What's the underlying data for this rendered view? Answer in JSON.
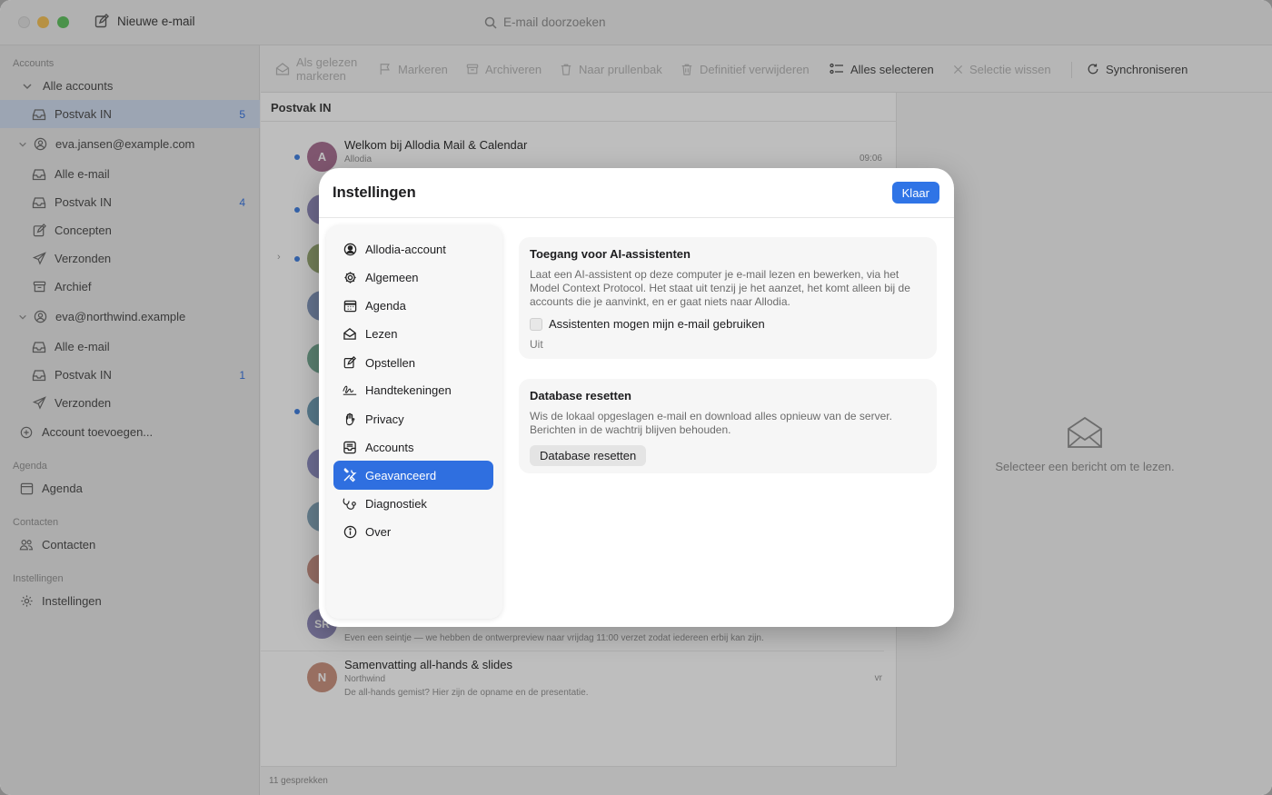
{
  "titlebar": {
    "new_mail": "Nieuwe e-mail",
    "search_placeholder": "E-mail doorzoeken"
  },
  "sidebar": {
    "accounts_header": "Accounts",
    "all_accounts": "Alle accounts",
    "inbox": "Postvak IN",
    "inbox_count": "5",
    "account1": {
      "email": "eva.jansen@example.com",
      "all_mail": "Alle e-mail",
      "inbox": "Postvak IN",
      "inbox_count": "4",
      "drafts": "Concepten",
      "sent": "Verzonden",
      "archive": "Archief"
    },
    "account2": {
      "email": "eva@northwind.example",
      "all_mail": "Alle e-mail",
      "inbox": "Postvak IN",
      "inbox_count": "1",
      "sent": "Verzonden"
    },
    "add_account": "Account toevoegen...",
    "agenda_header": "Agenda",
    "agenda": "Agenda",
    "contacts_header": "Contacten",
    "contacts": "Contacten",
    "settings_header": "Instellingen",
    "settings": "Instellingen"
  },
  "toolbar": {
    "mark_read_1": "Als gelezen",
    "mark_read_2": "markeren",
    "flag": "Markeren",
    "archive": "Archiveren",
    "trash": "Naar prullenbak",
    "delete": "Definitief verwijderen",
    "select_all": "Alles selecteren",
    "clear_selection": "Selectie wissen",
    "sync": "Synchroniseren"
  },
  "list": {
    "title": "Postvak IN",
    "footer": "11 gesprekken",
    "messages": [
      {
        "initial": "A",
        "subject": "Welkom bij Allodia Mail & Calendar",
        "sender": "Allodia",
        "time": "09:06",
        "color": "#a56a8e"
      },
      {
        "initial": "SR",
        "preview": "Even een seintje — we hebben de ontwerpreview naar vrijdag 11:00 verzet zodat iedereen erbij kan zijn.",
        "color": "#8b86b8"
      },
      {
        "initial": "N",
        "subject": "Samenvatting all-hands & slides",
        "sender": "Northwind",
        "preview": "De all-hands gemist? Hier zijn de opname en de presentatie.",
        "time": "vr",
        "color": "#c98e7a"
      }
    ]
  },
  "reader": {
    "empty": "Selecteer een bericht om te lezen."
  },
  "dialog": {
    "title": "Instellingen",
    "done": "Klaar",
    "nav": [
      {
        "label": "Allodia-account",
        "icon": "person-circle-icon"
      },
      {
        "label": "Algemeen",
        "icon": "gear-icon"
      },
      {
        "label": "Agenda",
        "icon": "calendar-icon"
      },
      {
        "label": "Lezen",
        "icon": "envelope-open-icon"
      },
      {
        "label": "Opstellen",
        "icon": "compose-icon"
      },
      {
        "label": "Handtekeningen",
        "icon": "signature-icon"
      },
      {
        "label": "Privacy",
        "icon": "hand-icon"
      },
      {
        "label": "Accounts",
        "icon": "tray-icon"
      },
      {
        "label": "Geavanceerd",
        "icon": "tools-icon"
      },
      {
        "label": "Diagnostiek",
        "icon": "stethoscope-icon"
      },
      {
        "label": "Over",
        "icon": "info-icon"
      }
    ],
    "ai": {
      "title": "Toegang voor AI-assistenten",
      "desc": "Laat een AI-assistent op deze computer je e-mail lezen en bewerken, via het Model Context Protocol. Het staat uit tenzij je het aanzet, het komt alleen bij de accounts die je aanvinkt, en er gaat niets naar Allodia.",
      "checkbox": "Assistenten mogen mijn e-mail gebruiken",
      "checked": false,
      "state": "Uit"
    },
    "db": {
      "title": "Database resetten",
      "desc": "Wis de lokaal opgeslagen e-mail en download alles opnieuw van de server. Berichten in de wachtrij blijven behouden.",
      "button": "Database resetten"
    }
  },
  "colors": {
    "accent": "#2f6fe0",
    "unread_dot": "#3a7be0"
  }
}
